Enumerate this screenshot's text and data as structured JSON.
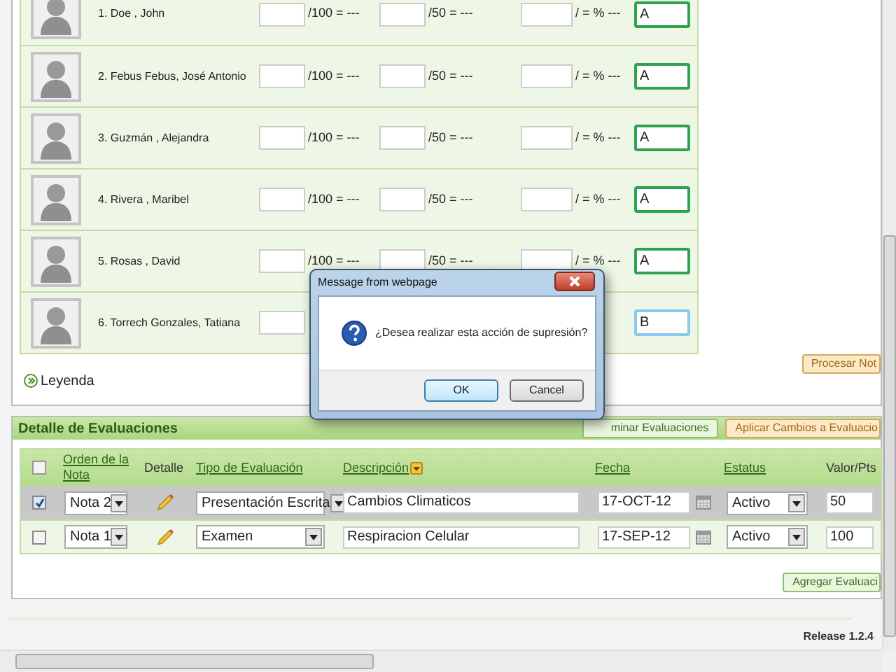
{
  "students": [
    {
      "name": "1. Doe , John",
      "score_100": "/100 = ---",
      "score_50": "/50 = ---",
      "percent": "/ = % ---",
      "grade": "A",
      "focused": false
    },
    {
      "name": "2. Febus Febus, José Antonio",
      "score_100": "/100 = ---",
      "score_50": "/50 = ---",
      "percent": "/ = % ---",
      "grade": "A",
      "focused": false
    },
    {
      "name": "3. Guzmán , Alejandra",
      "score_100": "/100 = ---",
      "score_50": "/50 = ---",
      "percent": "/ = % ---",
      "grade": "A",
      "focused": false
    },
    {
      "name": "4. Rivera , Maribel",
      "score_100": "/100 = ---",
      "score_50": "/50 = ---",
      "percent": "/ = % ---",
      "grade": "A",
      "focused": false
    },
    {
      "name": "5. Rosas , David",
      "score_100": "/100 = ---",
      "score_50": "/50 = ---",
      "percent": "/ = % ---",
      "grade": "A",
      "focused": false
    },
    {
      "name": "6. Torrech Gonzales, Tatiana",
      "grade": "B",
      "focused": true
    }
  ],
  "legend": "Leyenda",
  "process_button": "Procesar Not",
  "details": {
    "title": "Detalle de Evaluaciones",
    "select_all_checked": false,
    "buttons": [
      {
        "label": "minar Evaluaciones",
        "kind": "secondary"
      },
      {
        "label": "Aplicar Cambios a Evaluacio",
        "kind": "primary"
      }
    ],
    "columns": [
      {
        "label": "Orden de la Nota",
        "kind": "link"
      },
      {
        "label": "Detalle",
        "kind": "plain"
      },
      {
        "label": "Tipo de Evaluación",
        "kind": "link"
      },
      {
        "label": "Descripción",
        "kind": "sort"
      },
      {
        "label": "Fecha",
        "kind": "link"
      },
      {
        "label": "Estatus",
        "kind": "link"
      },
      {
        "label": "Valor/Pts",
        "kind": "plain"
      }
    ],
    "rows": [
      {
        "checked": true,
        "order": "Nota 2",
        "type": "Presentación Escrita",
        "description": "Cambios Climaticos",
        "date": "17-OCT-12",
        "status": "Activo",
        "points": "50"
      },
      {
        "checked": false,
        "order": "Nota 1",
        "type": "Examen",
        "description": "Respiracion Celular",
        "date": "17-SEP-12",
        "status": "Activo",
        "points": "100"
      }
    ],
    "add_button": "Agregar Evaluaci"
  },
  "release": "Release 1.2.4",
  "dialog": {
    "title": "Message from webpage",
    "message": "¿Desea realizar esta acción de supresión?",
    "buttons": [
      {
        "label": "OK",
        "selected": true
      },
      {
        "label": "Cancel",
        "selected": false
      }
    ]
  }
}
